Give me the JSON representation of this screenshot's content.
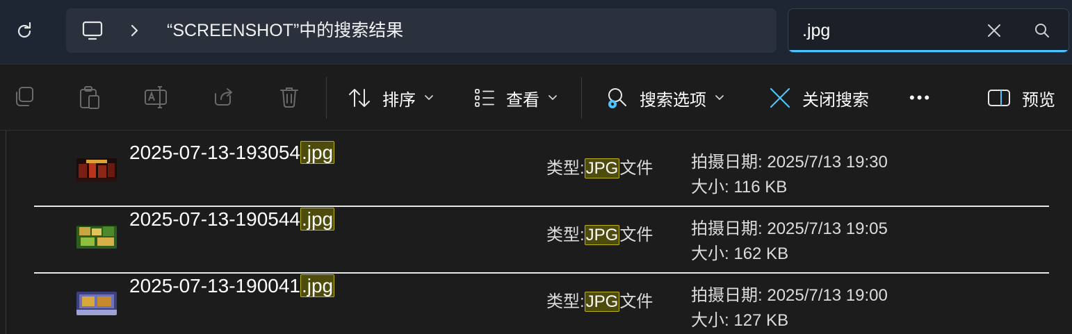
{
  "address": {
    "path": "“SCREENSHOT”中的搜索结果"
  },
  "search": {
    "value": ".jpg"
  },
  "toolbar": {
    "sort_label": "排序",
    "view_label": "查看",
    "search_options_label": "搜索选项",
    "close_search_label": "关闭搜索",
    "more_label": "•••",
    "preview_label": "预览"
  },
  "results": [
    {
      "name_stem": "2025-07-13-193054",
      "name_match": ".jpg",
      "type_prefix": "类型:",
      "type_match": "JPG",
      "type_suffix": "文件",
      "date_label": "拍摄日期:",
      "date_value": "2025/7/13 19:30",
      "size_label": "大小:",
      "size_value": "116 KB"
    },
    {
      "name_stem": "2025-07-13-190544",
      "name_match": ".jpg",
      "type_prefix": "类型:",
      "type_match": "JPG",
      "type_suffix": "文件",
      "date_label": "拍摄日期:",
      "date_value": "2025/7/13 19:05",
      "size_label": "大小:",
      "size_value": "162 KB"
    },
    {
      "name_stem": "2025-07-13-190041",
      "name_match": ".jpg",
      "type_prefix": "类型:",
      "type_match": "JPG",
      "type_suffix": "文件",
      "date_label": "拍摄日期:",
      "date_value": "2025/7/13 19:00",
      "size_label": "大小:",
      "size_value": "127 KB"
    }
  ],
  "colors": {
    "accent": "#4cc2ff",
    "highlight_bg": "#4e4c0c",
    "highlight_border": "#b9b218",
    "spellcheck": "#c8102e"
  }
}
